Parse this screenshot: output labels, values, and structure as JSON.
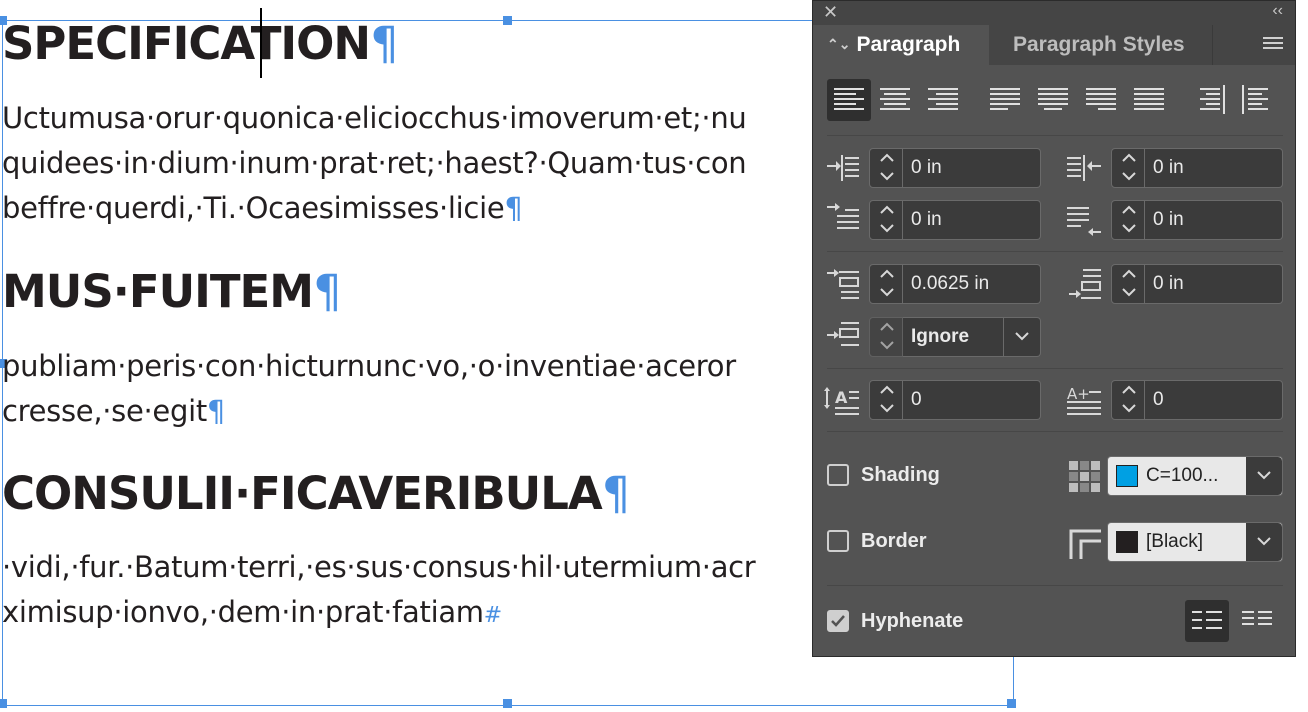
{
  "document": {
    "heading1": "SPECIFICATION",
    "para1": [
      "Uctumusa·orur·quonica·eliciocchus·imoverum·et;·nu",
      "quidees·in·dium·inum·prat·ret;·haest?·Quam·tus·con",
      "beffre·querdi,·Ti.·Ocaesimisses·licie"
    ],
    "heading2": "MUS·FUITEM",
    "para2": [
      "publiam·peris·con·hicturnunc·vo,·o·inventiae·aceror",
      "cresse,·se·egit"
    ],
    "heading3": "CONSULII·FICAVERIBULA",
    "para3": [
      "·vidi,·fur.·Batum·terri,·es·sus·consus·hil·utermium·acr",
      "ximisup·ionvo,·dem·in·prat·fatiam"
    ],
    "pilcrow": "¶",
    "end_of_story": "#"
  },
  "panel": {
    "close_glyph": "✕",
    "collapse_glyph": "‹‹",
    "tabs": [
      {
        "label": "Paragraph",
        "active": true
      },
      {
        "label": "Paragraph Styles",
        "active": false
      }
    ],
    "alignment": [
      {
        "name": "align-left",
        "selected": true
      },
      {
        "name": "align-center",
        "selected": false
      },
      {
        "name": "align-right",
        "selected": false
      },
      {
        "name": "justify-left",
        "selected": false
      },
      {
        "name": "justify-center",
        "selected": false
      },
      {
        "name": "justify-right",
        "selected": false
      },
      {
        "name": "justify-all",
        "selected": false
      },
      {
        "name": "align-towards-spine",
        "selected": false
      },
      {
        "name": "align-away-from-spine",
        "selected": false
      }
    ],
    "left_indent": "0 in",
    "right_indent": "0 in",
    "first_line_indent": "0 in",
    "last_line_right_indent": "0 in",
    "space_before": "0.0625 in",
    "space_after": "0 in",
    "align_to_grid": "Ignore",
    "drop_cap_lines": "0",
    "drop_cap_chars": "0",
    "shading": {
      "label": "Shading",
      "checked": false,
      "swatch": "C=100...",
      "color": "#00a0e3"
    },
    "border": {
      "label": "Border",
      "checked": false,
      "swatch": "[Black]",
      "color": "#231f20"
    },
    "hyphenate": {
      "label": "Hyphenate",
      "checked": true
    }
  },
  "colors": {
    "frame_blue": "#4a90e2",
    "panel_bg": "#535353",
    "text": "#231f20"
  }
}
